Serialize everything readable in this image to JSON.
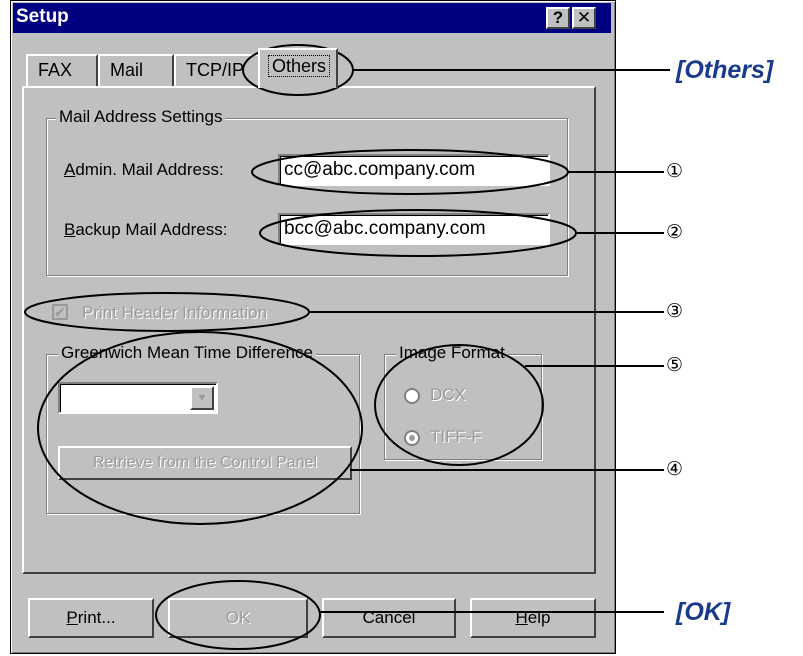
{
  "dialog": {
    "title": "Setup",
    "help_button": "?",
    "close_button": "✕"
  },
  "tabs": [
    {
      "label": "FAX",
      "active": false
    },
    {
      "label": "Mail",
      "active": false
    },
    {
      "label": "TCP/IP",
      "active": false
    },
    {
      "label": "Others",
      "active": true
    }
  ],
  "mail_settings": {
    "group_label": "Mail Address Settings",
    "admin_label": "Admin. Mail Address:",
    "admin_value": "cc@abc.company.com",
    "backup_label": "Backup Mail Address:",
    "backup_value": "bcc@abc.company.com"
  },
  "print_header": {
    "label": "Print Header Information",
    "checked": true
  },
  "gmt": {
    "group_label": "Greenwich Mean Time Difference",
    "selected_value": "",
    "retrieve_button": "Retrieve from the Control Panel"
  },
  "image_format": {
    "group_label": "Image Format",
    "options": [
      "DCX",
      "TIFF-F"
    ],
    "selected": "TIFF-F"
  },
  "buttons": {
    "print": "Print...",
    "ok": "OK",
    "cancel": "Cancel",
    "help": "Help"
  },
  "annotations": {
    "others_callout": "[Others]",
    "ok_callout": "[OK]",
    "markers": [
      "①",
      "②",
      "③",
      "④",
      "⑤"
    ]
  },
  "colors": {
    "titlebar": "#000080",
    "dialog_bg": "#c0c0c0",
    "callout_text": "#1a3a8c",
    "highlight_ellipse": "#000000"
  }
}
